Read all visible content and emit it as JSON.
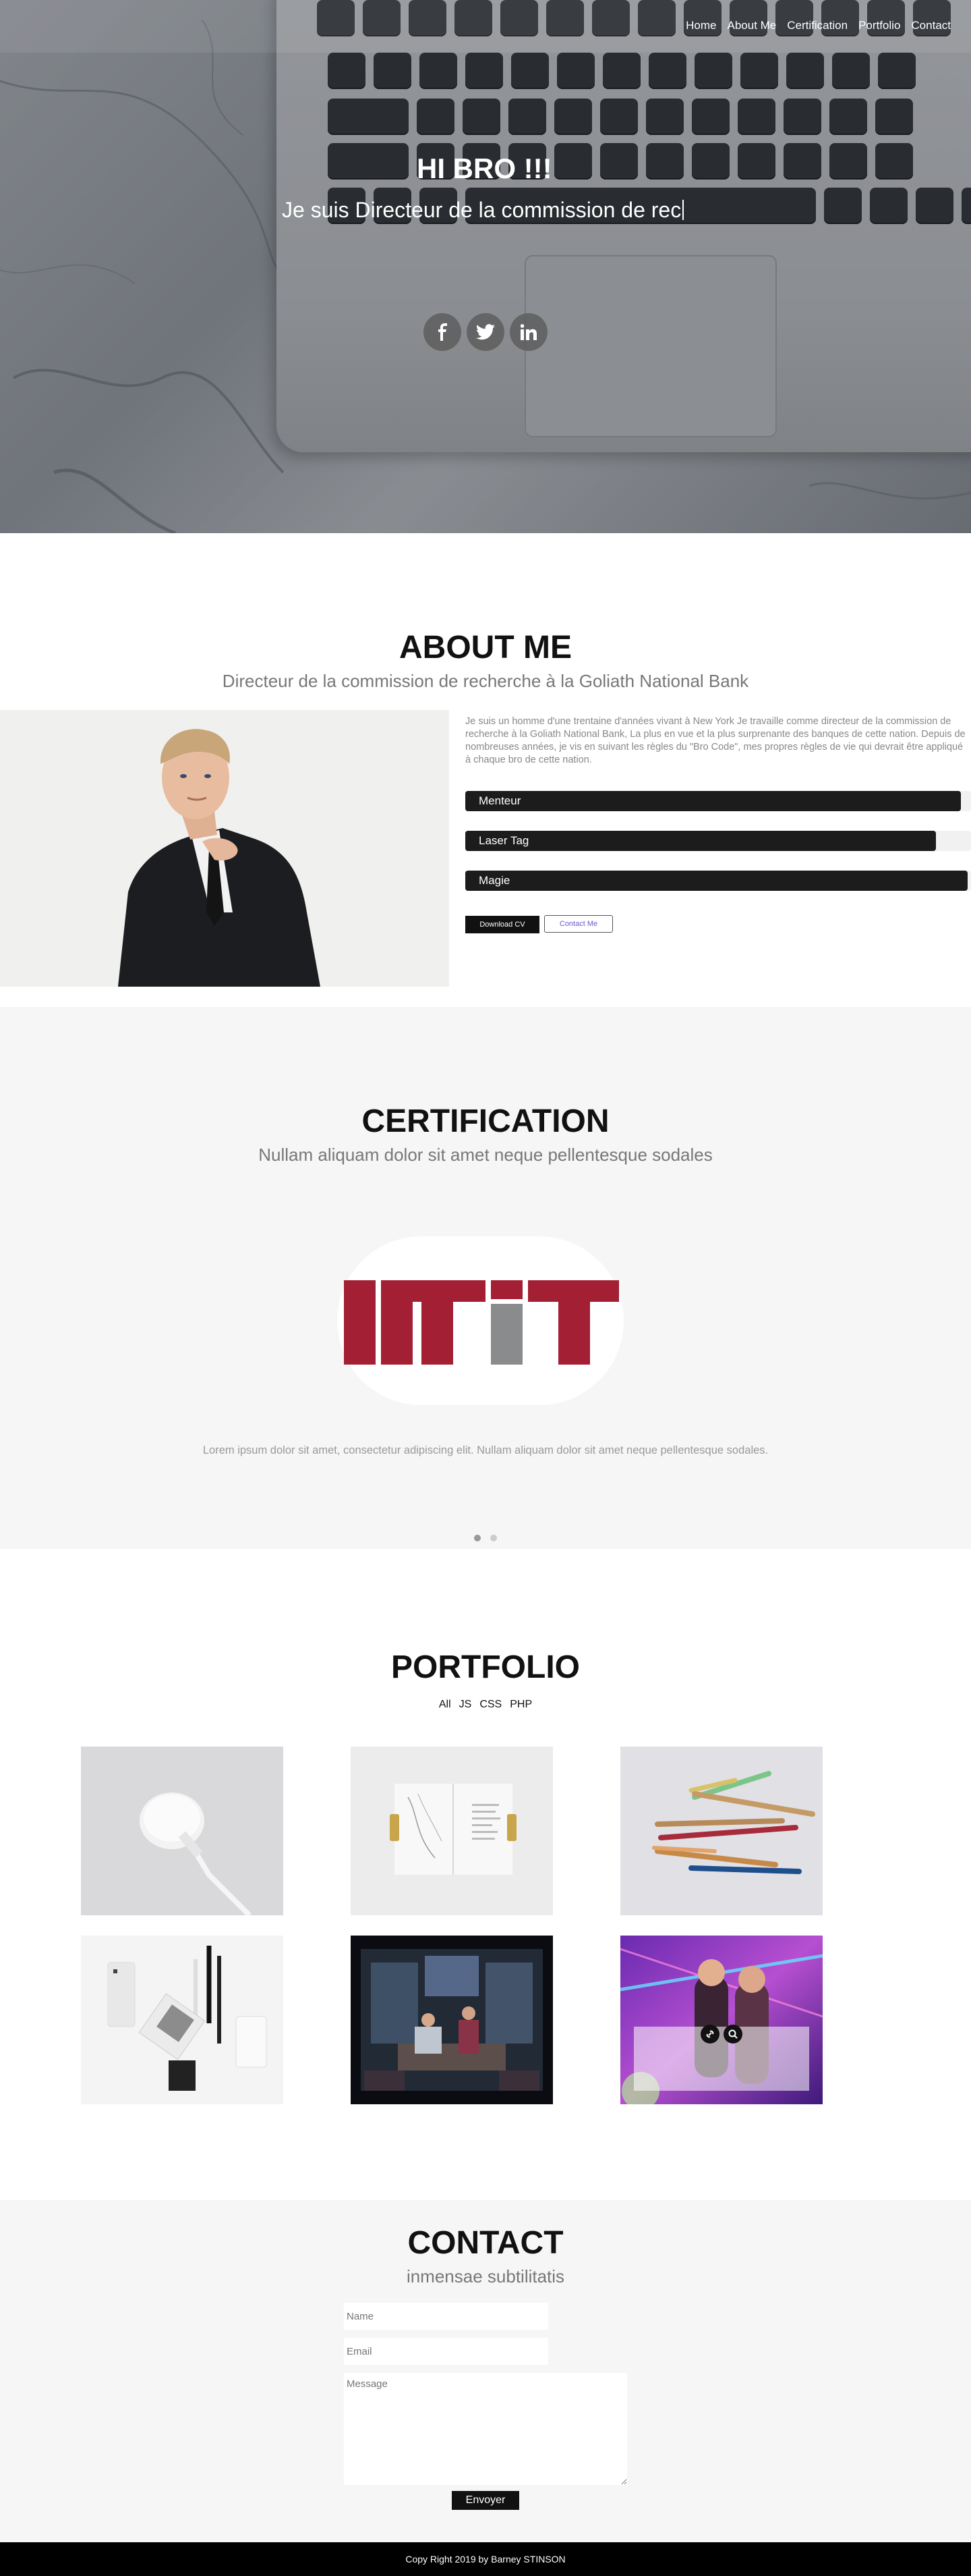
{
  "nav": {
    "items": [
      {
        "label": "Home"
      },
      {
        "label": "About Me"
      },
      {
        "label": "Certification"
      },
      {
        "label": "Portfolio"
      },
      {
        "label": "Contact"
      }
    ]
  },
  "hero": {
    "title": "HI BRO !!!",
    "subtitle": "Je suis Directeur de la commission de rec",
    "socials": [
      {
        "name": "facebook-icon",
        "glyph": "f"
      },
      {
        "name": "twitter-icon",
        "glyph": "t"
      },
      {
        "name": "linkedin-icon",
        "glyph": "in"
      }
    ]
  },
  "about": {
    "title": "ABOUT ME",
    "subtitle": "Directeur de la commission de recherche à la Goliath National Bank",
    "paragraph": "Je suis un homme d'une trentaine d'années vivant à New York Je travaille comme directeur de la commission de recherche à la Goliath National Bank, La plus en vue et la plus surprenante des banques de cette nation. Depuis de nombreuses années, je vis en suivant les règles du \"Bro Code\", mes propres règles de vie qui devrait être appliqué à chaque bro de cette nation.",
    "skills": [
      {
        "label": "Menteur",
        "level": 0.98
      },
      {
        "label": "Laser Tag",
        "level": 0.93
      },
      {
        "label": "Magie",
        "level": 0.9933
      }
    ],
    "download_label": "Download CV",
    "contact_label": "Contact Me"
  },
  "certification": {
    "title": "CERTIFICATION",
    "subtitle": "Nullam aliquam dolor sit amet neque pellentesque sodales",
    "text": "Lorem ipsum dolor sit amet, consectetur adipiscing elit. Nullam aliquam dolor sit amet neque pellentesque sodales.",
    "logo_colors": {
      "red": "#a31f34",
      "gray": "#8a8b8c"
    },
    "slides": 2,
    "active_slide": 1
  },
  "portfolio": {
    "title": "PORTFOLIO",
    "filters": [
      "All",
      "JS",
      "CSS",
      "PHP"
    ],
    "items": [
      {
        "name": "portfolio-watch-charger"
      },
      {
        "name": "portfolio-open-book"
      },
      {
        "name": "portfolio-colored-pencils"
      },
      {
        "name": "portfolio-stationery"
      },
      {
        "name": "portfolio-sitcom-scene"
      },
      {
        "name": "portfolio-party-scene"
      }
    ]
  },
  "contact": {
    "title": "CONTACT",
    "subtitle": "inmensae subtilitatis",
    "name_placeholder": "Name",
    "email_placeholder": "Email",
    "message_placeholder": "Message",
    "submit_label": "Envoyer"
  },
  "footer": {
    "text": "Copy Right 2019 by Barney STINSON"
  }
}
